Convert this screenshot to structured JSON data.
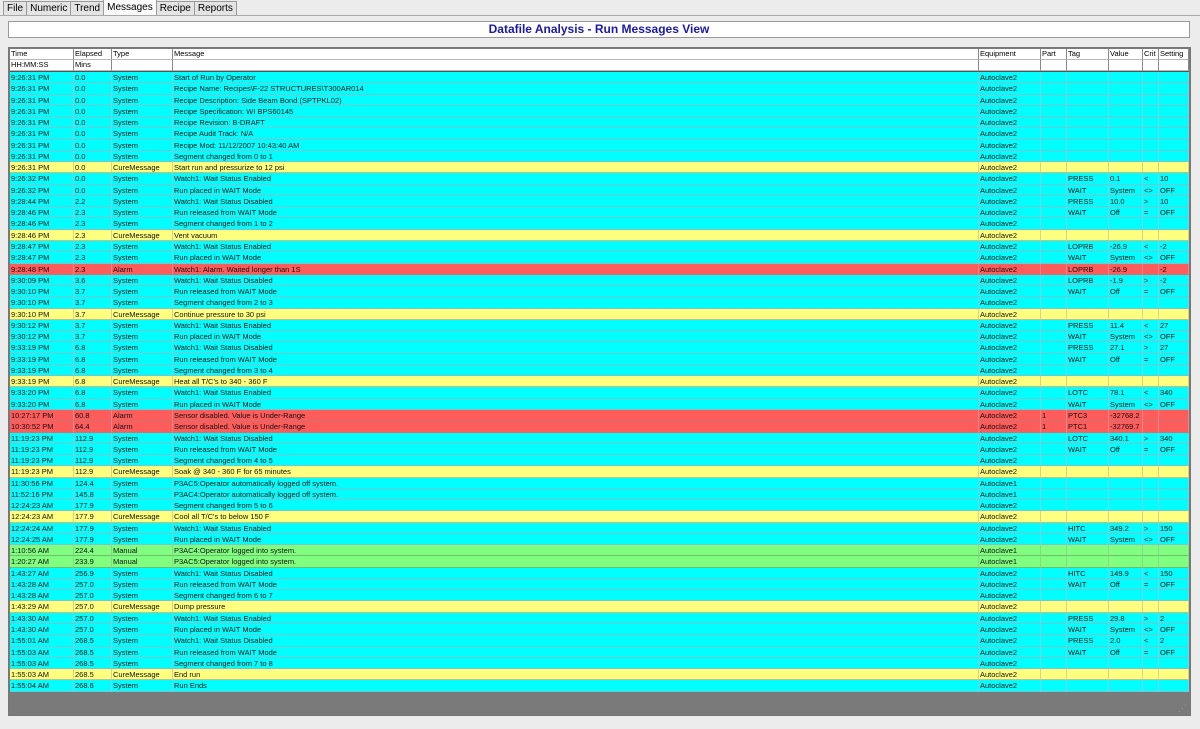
{
  "tabs": [
    "File",
    "Numeric",
    "Trend",
    "Messages",
    "Recipe",
    "Reports"
  ],
  "active_tab": "Messages",
  "view_title": "Datafile Analysis - Run Messages View",
  "columns": [
    "Time",
    "Elapsed",
    "Type",
    "Message",
    "Equipment",
    "Part",
    "Tag",
    "Value",
    "Crit",
    "Setting"
  ],
  "units": [
    "HH:MM:SS",
    "Mins",
    "",
    "",
    "",
    "",
    "",
    "",
    "",
    ""
  ],
  "row_colors": {
    "System": "#00ffff",
    "CureMessage": "#ffff80",
    "Alarm": "#ff5c5c",
    "Manual": "#80ff80"
  },
  "rows": [
    [
      "9:26:31 PM",
      "0.0",
      "System",
      "Start of Run by Operator",
      "Autoclave2",
      "",
      "",
      "",
      "",
      ""
    ],
    [
      "9:26:31 PM",
      "0.0",
      "System",
      "Recipe Name: Recipes\\F-22 STRUCTURES\\T300AR014",
      "Autoclave2",
      "",
      "",
      "",
      "",
      ""
    ],
    [
      "9:26:31 PM",
      "0.0",
      "System",
      "Recipe Description: Side Beam Bond (SPTPKL02)",
      "Autoclave2",
      "",
      "",
      "",
      "",
      ""
    ],
    [
      "9:26:31 PM",
      "0.0",
      "System",
      "Recipe Specification: WI BPS60145",
      "Autoclave2",
      "",
      "",
      "",
      "",
      ""
    ],
    [
      "9:26:31 PM",
      "0.0",
      "System",
      "Recipe Revision: B-DRAFT",
      "Autoclave2",
      "",
      "",
      "",
      "",
      ""
    ],
    [
      "9:26:31 PM",
      "0.0",
      "System",
      "Recipe Audit Track: N/A",
      "Autoclave2",
      "",
      "",
      "",
      "",
      ""
    ],
    [
      "9:26:31 PM",
      "0.0",
      "System",
      "Recipe Mod: 11/12/2007 10:43:40 AM",
      "Autoclave2",
      "",
      "",
      "",
      "",
      ""
    ],
    [
      "9:26:31 PM",
      "0.0",
      "System",
      "Segment changed from 0 to 1",
      "Autoclave2",
      "",
      "",
      "",
      "",
      ""
    ],
    [
      "9:26:31 PM",
      "0.0",
      "CureMessage",
      "Start run and pressurize to 12 psi",
      "Autoclave2",
      "",
      "",
      "",
      "",
      ""
    ],
    [
      "9:26:32 PM",
      "0.0",
      "System",
      "Watch1: Wait Status Enabled",
      "Autoclave2",
      "",
      "PRESS",
      "0.1",
      "<",
      "10"
    ],
    [
      "9:26:32 PM",
      "0.0",
      "System",
      "Run placed in WAIT Mode",
      "Autoclave2",
      "",
      "WAIT",
      "System",
      "<>",
      "OFF"
    ],
    [
      "9:28:44 PM",
      "2.2",
      "System",
      "Watch1: Wait Status Disabled",
      "Autoclave2",
      "",
      "PRESS",
      "10.0",
      ">",
      "10"
    ],
    [
      "9:28:46 PM",
      "2.3",
      "System",
      "Run released from WAIT Mode",
      "Autoclave2",
      "",
      "WAIT",
      "Off",
      "=",
      "OFF"
    ],
    [
      "9:28:46 PM",
      "2.3",
      "System",
      "Segment changed from 1 to 2",
      "Autoclave2",
      "",
      "",
      "",
      "",
      ""
    ],
    [
      "9:28:46 PM",
      "2.3",
      "CureMessage",
      "Vent vacuum",
      "Autoclave2",
      "",
      "",
      "",
      "",
      ""
    ],
    [
      "9:28:47 PM",
      "2.3",
      "System",
      "Watch1: Wait Status Enabled",
      "Autoclave2",
      "",
      "LOPRB",
      "-26.9",
      "<",
      "-2"
    ],
    [
      "9:28:47 PM",
      "2.3",
      "System",
      "Run placed in WAIT Mode",
      "Autoclave2",
      "",
      "WAIT",
      "System",
      "<>",
      "OFF"
    ],
    [
      "9:28:48 PM",
      "2.3",
      "Alarm",
      "Watch1: Alarm. Waited longer than 1S",
      "Autoclave2",
      "",
      "LOPRB",
      "-26.9",
      "",
      "-2"
    ],
    [
      "9:30:09 PM",
      "3.6",
      "System",
      "Watch1: Wait Status Disabled",
      "Autoclave2",
      "",
      "LOPRB",
      "-1.9",
      ">",
      "-2"
    ],
    [
      "9:30:10 PM",
      "3.7",
      "System",
      "Run released from WAIT Mode",
      "Autoclave2",
      "",
      "WAIT",
      "Off",
      "=",
      "OFF"
    ],
    [
      "9:30:10 PM",
      "3.7",
      "System",
      "Segment changed from 2 to 3",
      "Autoclave2",
      "",
      "",
      "",
      "",
      ""
    ],
    [
      "9:30:10 PM",
      "3.7",
      "CureMessage",
      "Continue pressure to 30 psi",
      "Autoclave2",
      "",
      "",
      "",
      "",
      ""
    ],
    [
      "9:30:12 PM",
      "3.7",
      "System",
      "Watch1: Wait Status Enabled",
      "Autoclave2",
      "",
      "PRESS",
      "11.4",
      "<",
      "27"
    ],
    [
      "9:30:12 PM",
      "3.7",
      "System",
      "Run placed in WAIT Mode",
      "Autoclave2",
      "",
      "WAIT",
      "System",
      "<>",
      "OFF"
    ],
    [
      "9:33:19 PM",
      "6.8",
      "System",
      "Watch1: Wait Status Disabled",
      "Autoclave2",
      "",
      "PRESS",
      "27.1",
      ">",
      "27"
    ],
    [
      "9:33:19 PM",
      "6.8",
      "System",
      "Run released from WAIT Mode",
      "Autoclave2",
      "",
      "WAIT",
      "Off",
      "=",
      "OFF"
    ],
    [
      "9:33:19 PM",
      "6.8",
      "System",
      "Segment changed from 3 to 4",
      "Autoclave2",
      "",
      "",
      "",
      "",
      ""
    ],
    [
      "9:33:19 PM",
      "6.8",
      "CureMessage",
      "Heat all T/C's to 340 - 360 F",
      "Autoclave2",
      "",
      "",
      "",
      "",
      ""
    ],
    [
      "9:33:20 PM",
      "6.8",
      "System",
      "Watch1: Wait Status Enabled",
      "Autoclave2",
      "",
      "LOTC",
      "78.1",
      "<",
      "340"
    ],
    [
      "9:33:20 PM",
      "6.8",
      "System",
      "Run placed in WAIT Mode",
      "Autoclave2",
      "",
      "WAIT",
      "System",
      "<>",
      "OFF"
    ],
    [
      "10:27:17 PM",
      "60.8",
      "Alarm",
      "Sensor disabled.  Value is Under-Range",
      "Autoclave2",
      "1",
      "PTC3",
      "-32768.2",
      "",
      ""
    ],
    [
      "10:30:52 PM",
      "64.4",
      "Alarm",
      "Sensor disabled.  Value is Under-Range",
      "Autoclave2",
      "1",
      "PTC1",
      "-32769.7",
      "",
      ""
    ],
    [
      "11:19:23 PM",
      "112.9",
      "System",
      "Watch1: Wait Status Disabled",
      "Autoclave2",
      "",
      "LOTC",
      "340.1",
      ">",
      "340"
    ],
    [
      "11:19:23 PM",
      "112.9",
      "System",
      "Run released from WAIT Mode",
      "Autoclave2",
      "",
      "WAIT",
      "Off",
      "=",
      "OFF"
    ],
    [
      "11:19:23 PM",
      "112.9",
      "System",
      "Segment changed from 4 to 5",
      "Autoclave2",
      "",
      "",
      "",
      "",
      ""
    ],
    [
      "11:19:23 PM",
      "112.9",
      "CureMessage",
      "Soak @ 340 - 360 F for 65 minutes",
      "Autoclave2",
      "",
      "",
      "",
      "",
      ""
    ],
    [
      "11:30:56 PM",
      "124.4",
      "System",
      "P3AC5:Operator automatically logged off system.",
      "Autoclave1",
      "",
      "",
      "",
      "",
      ""
    ],
    [
      "11:52:16 PM",
      "145.8",
      "System",
      "P3AC4:Operator automatically logged off system.",
      "Autoclave1",
      "",
      "",
      "",
      "",
      ""
    ],
    [
      "12:24:23 AM",
      "177.9",
      "System",
      "Segment changed from 5 to 6",
      "Autoclave2",
      "",
      "",
      "",
      "",
      ""
    ],
    [
      "12:24:23 AM",
      "177.9",
      "CureMessage",
      "Cool all T/C's to below 150 F",
      "Autoclave2",
      "",
      "",
      "",
      "",
      ""
    ],
    [
      "12:24:24 AM",
      "177.9",
      "System",
      "Watch1: Wait Status Enabled",
      "Autoclave2",
      "",
      "HITC",
      "349.2",
      ">",
      "150"
    ],
    [
      "12:24:25 AM",
      "177.9",
      "System",
      "Run placed in WAIT Mode",
      "Autoclave2",
      "",
      "WAIT",
      "System",
      "<>",
      "OFF"
    ],
    [
      "1:10:56 AM",
      "224.4",
      "Manual",
      "P3AC4:Operator logged into system.",
      "Autoclave1",
      "",
      "",
      "",
      "",
      ""
    ],
    [
      "1:20:27 AM",
      "233.9",
      "Manual",
      "P3AC5:Operator logged into system.",
      "Autoclave1",
      "",
      "",
      "",
      "",
      ""
    ],
    [
      "1:43:27 AM",
      "256.9",
      "System",
      "Watch1: Wait Status Disabled",
      "Autoclave2",
      "",
      "HITC",
      "149.9",
      "<",
      "150"
    ],
    [
      "1:43:28 AM",
      "257.0",
      "System",
      "Run released from WAIT Mode",
      "Autoclave2",
      "",
      "WAIT",
      "Off",
      "=",
      "OFF"
    ],
    [
      "1:43:28 AM",
      "257.0",
      "System",
      "Segment changed from 6 to 7",
      "Autoclave2",
      "",
      "",
      "",
      "",
      ""
    ],
    [
      "1:43:29 AM",
      "257.0",
      "CureMessage",
      "Dump pressure",
      "Autoclave2",
      "",
      "",
      "",
      "",
      ""
    ],
    [
      "1:43:30 AM",
      "257.0",
      "System",
      "Watch1: Wait Status Enabled",
      "Autoclave2",
      "",
      "PRESS",
      "29.8",
      ">",
      "2"
    ],
    [
      "1:43:30 AM",
      "257.0",
      "System",
      "Run placed in WAIT Mode",
      "Autoclave2",
      "",
      "WAIT",
      "System",
      "<>",
      "OFF"
    ],
    [
      "1:55:01 AM",
      "268.5",
      "System",
      "Watch1: Wait Status Disabled",
      "Autoclave2",
      "",
      "PRESS",
      "2.0",
      "<",
      "2"
    ],
    [
      "1:55:03 AM",
      "268.5",
      "System",
      "Run released from WAIT Mode",
      "Autoclave2",
      "",
      "WAIT",
      "Off",
      "=",
      "OFF"
    ],
    [
      "1:55:03 AM",
      "268.5",
      "System",
      "Segment changed from 7 to 8",
      "Autoclave2",
      "",
      "",
      "",
      "",
      ""
    ],
    [
      "1:55:03 AM",
      "268.5",
      "CureMessage",
      "End run",
      "Autoclave2",
      "",
      "",
      "",
      "",
      ""
    ],
    [
      "1:55:04 AM",
      "268.6",
      "System",
      "Run Ends",
      "Autoclave2",
      "",
      "",
      "",
      "",
      ""
    ]
  ]
}
